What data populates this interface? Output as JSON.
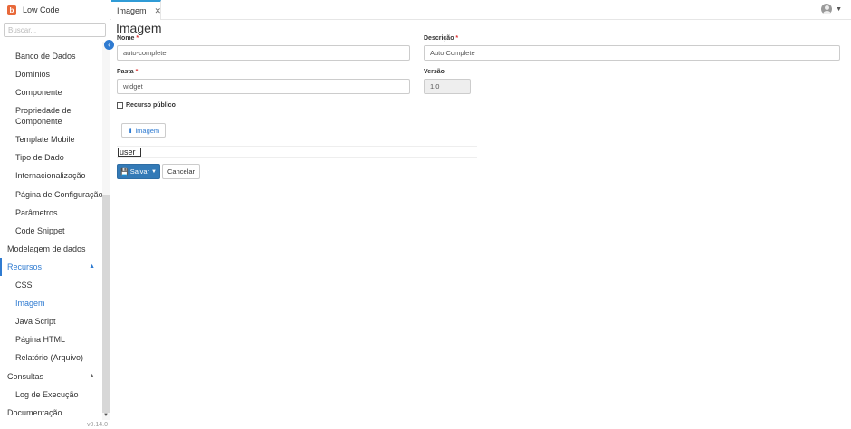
{
  "app": {
    "brand_name": "Low Code",
    "version": "v0.14.0"
  },
  "sidebar": {
    "search_placeholder": "Buscar...",
    "items": [
      {
        "label": "Banco de Dados"
      },
      {
        "label": "Domínios"
      },
      {
        "label": "Componente"
      },
      {
        "label": "Propriedade de Componente"
      },
      {
        "label": "Template Mobile"
      },
      {
        "label": "Tipo de Dado"
      },
      {
        "label": "Internacionalização"
      },
      {
        "label": "Página de Configuração"
      },
      {
        "label": "Parâmetros"
      },
      {
        "label": "Code Snippet"
      },
      {
        "label": "Modelagem de dados"
      },
      {
        "label": "Recursos"
      },
      {
        "label": "CSS"
      },
      {
        "label": "Imagem"
      },
      {
        "label": "Java Script"
      },
      {
        "label": "Página HTML"
      },
      {
        "label": "Relatório (Arquivo)"
      },
      {
        "label": "Consultas"
      },
      {
        "label": "Log de Execução"
      },
      {
        "label": "Documentação"
      }
    ]
  },
  "tabs": [
    {
      "label": "Imagem",
      "active": true
    }
  ],
  "form": {
    "title": "Imagem",
    "nome": {
      "label": "Nome",
      "required_mark": "*",
      "value": "auto-complete"
    },
    "descricao": {
      "label": "Descrição",
      "required_mark": "*",
      "value": "Auto Complete"
    },
    "pasta": {
      "label": "Pasta",
      "required_mark": "*",
      "value": "widget"
    },
    "versao": {
      "label": "Versão",
      "value": "1.0"
    },
    "recurso_publico": {
      "label": "Recurso público",
      "checked": false
    },
    "upload_label": "imagem",
    "preview_text": "user",
    "save_label": "Salvar",
    "cancel_label": "Cancelar"
  },
  "colors": {
    "accent": "#2f7bd1",
    "primary_button": "#337ab7",
    "brand": "#e8693a"
  },
  "icons": [
    "brand-logo-icon",
    "collapse-sidebar-icon",
    "close-icon",
    "user-avatar-icon",
    "upload-icon",
    "save-icon",
    "chevron-up-icon",
    "chevron-down-icon"
  ]
}
